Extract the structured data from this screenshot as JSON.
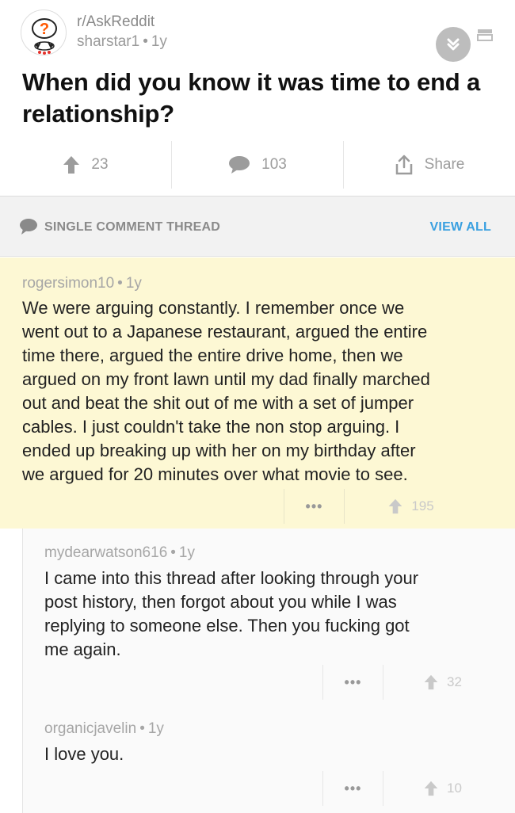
{
  "post": {
    "subreddit": "r/AskReddit",
    "author": "sharstar1",
    "age": "1y",
    "title": "When did you know it was time to end a relationship?",
    "upvotes": "23",
    "comments": "103",
    "share_label": "Share"
  },
  "thread": {
    "label": "SINGLE COMMENT THREAD",
    "view_all": "VIEW ALL"
  },
  "comments": [
    {
      "author": "rogersimon10",
      "age": "1y",
      "lines": [
        "We were arguing constantly. I remember once we",
        "went out to a Japanese restaurant, argued the entire",
        "time there, argued the entire drive home, then we",
        "argued on my front lawn until my dad finally marched",
        "out and beat the shit out of me with a set of jumper",
        "cables. I just couldn't take the non stop arguing. I",
        "ended up breaking up with her on my birthday after",
        "we argued for 20 minutes over what movie to see."
      ],
      "more": "•••",
      "score": "195"
    },
    {
      "author": "mydearwatson616",
      "age": "1y",
      "lines": [
        "I came into this thread after looking through your",
        "post history, then forgot about you while I was",
        "replying to someone else. Then you fucking got",
        "me again."
      ],
      "more": "•••",
      "score": "32"
    },
    {
      "author": "organicjavelin",
      "age": "1y",
      "lines": [
        "I love you."
      ],
      "more": "•••",
      "score": "10"
    }
  ],
  "colors": {
    "highlight": "#fdf8d4",
    "link": "#3aa0e0",
    "muted": "#9c9c9c"
  },
  "icons": [
    "snoo-avatar-icon",
    "collapse-chevron-icon",
    "card-view-icon",
    "upvote-arrow-icon",
    "comment-bubble-icon",
    "share-icon",
    "more-dots-icon"
  ]
}
